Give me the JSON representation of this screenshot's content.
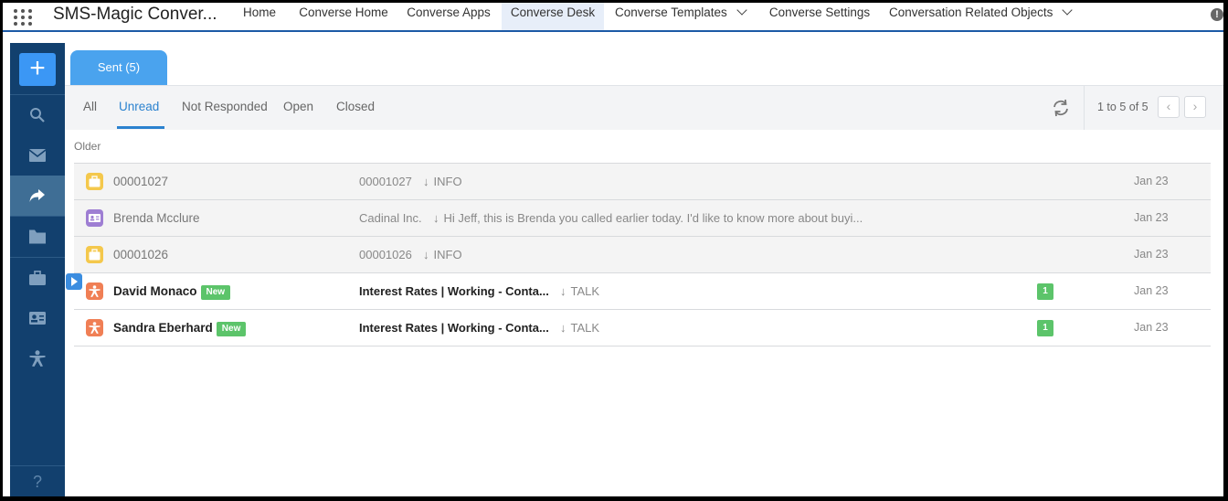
{
  "app": {
    "name": "SMS-Magic Conver..."
  },
  "nav": {
    "tabs": [
      {
        "label": "Home"
      },
      {
        "label": "Converse Home"
      },
      {
        "label": "Converse Apps"
      },
      {
        "label": "Converse Desk"
      },
      {
        "label": "Converse Templates"
      },
      {
        "label": "Converse Settings"
      },
      {
        "label": "Conversation Related Objects"
      }
    ],
    "active": "Converse Desk",
    "info_icon": "!"
  },
  "rail": {
    "add_label": "+",
    "items": [
      "search-icon",
      "mail-icon",
      "forward-icon",
      "folder-icon",
      "briefcase-icon",
      "contact-card-icon",
      "person-icon"
    ],
    "selected": "forward-icon",
    "help_label": "?"
  },
  "view_tab": {
    "label": "Sent (5)"
  },
  "filters": {
    "items": [
      "All",
      "Unread",
      "Not Responded",
      "Open",
      "Closed"
    ],
    "active": "Unread"
  },
  "pager": {
    "text": "1 to 5 of 5",
    "prev": "‹",
    "next": "›"
  },
  "group_label": "Older",
  "rows": [
    {
      "name": "00001027",
      "new": false,
      "new_label": "",
      "subject": "00001027",
      "direction": "INFO",
      "count": "",
      "date": "Jan 23",
      "unread": false,
      "icon": "case-icon",
      "icon_color": "#f4c84c"
    },
    {
      "name": "Brenda Mcclure",
      "new": false,
      "new_label": "",
      "subject": "Cadinal Inc.",
      "direction": "Hi Jeff, this is Brenda you called earlier today. I'd like to know more about buyi...",
      "count": "",
      "date": "Jan 23",
      "unread": false,
      "icon": "contact-icon",
      "icon_color": "#9e7ed3"
    },
    {
      "name": "00001026",
      "new": false,
      "new_label": "",
      "subject": "00001026",
      "direction": "INFO",
      "count": "",
      "date": "Jan 23",
      "unread": false,
      "icon": "case-icon",
      "icon_color": "#f4c84c"
    },
    {
      "name": "David Monaco",
      "new": true,
      "new_label": "New",
      "subject": "Interest Rates | Working - Conta...",
      "direction": "TALK",
      "count": "1",
      "date": "Jan 23",
      "unread": true,
      "icon": "lead-icon",
      "icon_color": "#f07f55"
    },
    {
      "name": "Sandra Eberhard",
      "new": true,
      "new_label": "New",
      "subject": "Interest Rates | Working - Conta...",
      "direction": "TALK",
      "count": "1",
      "date": "Jan 23",
      "unread": true,
      "icon": "lead-icon",
      "icon_color": "#f07f55"
    }
  ],
  "colors": {
    "accent": "#2b82cf",
    "rail": "#12406e",
    "new_badge": "#5cc46a",
    "tab": "#4aa3ee"
  }
}
